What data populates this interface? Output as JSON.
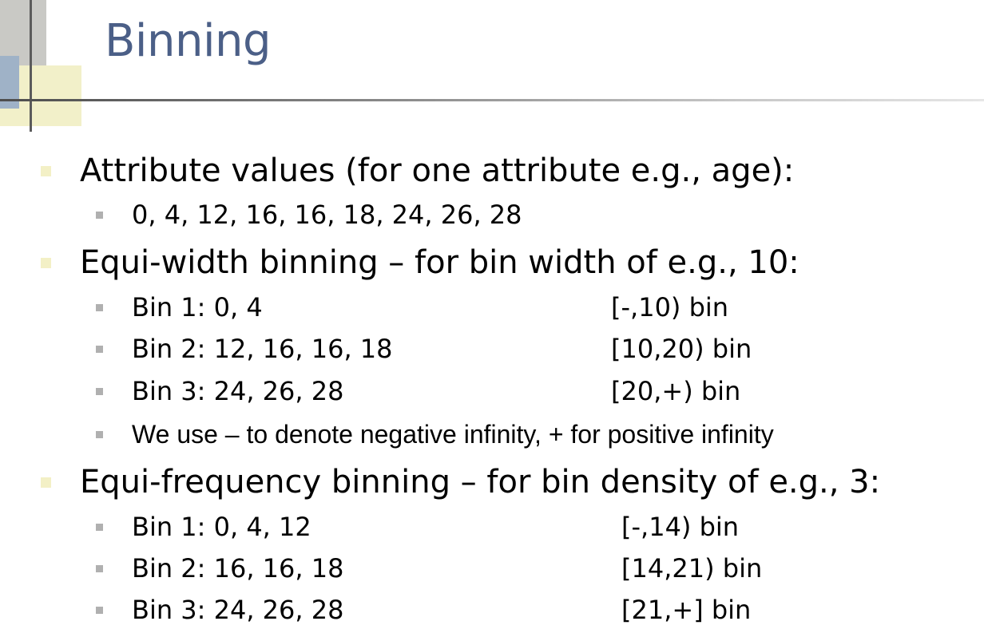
{
  "slide": {
    "title": "Binning",
    "sections": [
      {
        "heading": "Attribute values (for one attribute e.g., age):",
        "items": [
          {
            "text": "0, 4, 12, 16, 16, 18, 24, 26, 28"
          }
        ]
      },
      {
        "heading": "Equi-width binning – for bin width of e.g., 10:",
        "items": [
          {
            "text": "Bin 1: 0, 4",
            "range": "[-,10) bin"
          },
          {
            "text": "Bin 2: 12, 16, 16, 18",
            "range": "[10,20) bin"
          },
          {
            "text": "Bin 3: 24, 26, 28",
            "range": "[20,+) bin"
          },
          {
            "text": "We use – to denote negative infinity, + for positive infinity"
          }
        ]
      },
      {
        "heading": "Equi-frequency binning – for bin density of e.g., 3:",
        "items": [
          {
            "text": "Bin 1: 0, 4, 12",
            "range": "[-,14) bin"
          },
          {
            "text": "Bin 2: 16, 16, 18",
            "range": "[14,21) bin"
          },
          {
            "text": "Bin 3: 24, 26, 28",
            "range": "[21,+] bin"
          }
        ]
      }
    ]
  },
  "colors": {
    "title": "#4b5f87",
    "text": "#000000",
    "main_bullet": "#f3f0c6",
    "sub_bullet": "#b0b0b0"
  }
}
